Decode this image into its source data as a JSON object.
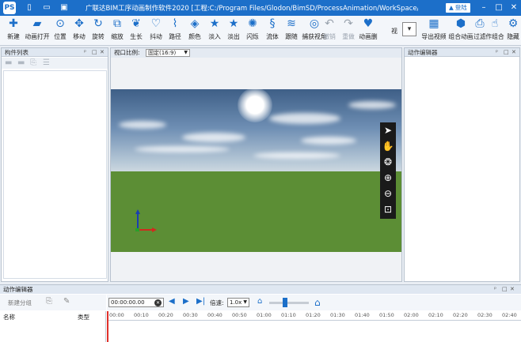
{
  "titlebar": {
    "logo": "PS",
    "title": "广联达BIM工序动画制作软件2020 [工程:C:/Program Files/Glodon/BimSD/ProcessAnimation/WorkSpace/新建项目]",
    "login_label": "登陆",
    "colors": {
      "bar": "#1c6fc9"
    }
  },
  "ribbon": {
    "tools": [
      {
        "label": "新建",
        "icon": "plus-icon"
      },
      {
        "label": "动画打开",
        "icon": "folder-open-icon"
      },
      {
        "label": "位置",
        "icon": "location-pin-icon"
      },
      {
        "label": "移动",
        "icon": "move-arrows-icon"
      },
      {
        "label": "旋转",
        "icon": "rotate-icon"
      },
      {
        "label": "缩放",
        "icon": "scale-icon"
      },
      {
        "label": "生长",
        "icon": "grow-icon"
      },
      {
        "label": "抖动",
        "icon": "shake-icon"
      },
      {
        "label": "路径",
        "icon": "path-icon"
      },
      {
        "label": "颜色",
        "icon": "paint-bucket-icon"
      },
      {
        "label": "淡入",
        "icon": "star-icon"
      },
      {
        "label": "淡出",
        "icon": "star-icon"
      },
      {
        "label": "闪烁",
        "icon": "flash-icon"
      },
      {
        "label": "流体",
        "icon": "fluid-icon"
      },
      {
        "label": "跟随",
        "icon": "follow-icon"
      },
      {
        "label": "捕获视角",
        "icon": "camera-capture-icon"
      },
      {
        "label": "撤销",
        "icon": "undo-icon",
        "disabled": true
      },
      {
        "label": "重做",
        "icon": "redo-icon",
        "disabled": true
      },
      {
        "label": "动画删",
        "icon": "delete-animation-icon"
      },
      {
        "label": "视",
        "icon": "view-icon"
      },
      {
        "label": "导出视频",
        "icon": "export-video-icon"
      },
      {
        "label": "组合动画",
        "icon": "group-animation-icon"
      },
      {
        "label": "过滤",
        "icon": "filter-icon"
      },
      {
        "label": "作组合",
        "icon": "combine-icon"
      },
      {
        "label": "隐藏",
        "icon": "hide-icon"
      }
    ]
  },
  "left_panel": {
    "title": "构件列表"
  },
  "viewport": {
    "ratio_label": "视口比例:",
    "ratio_value": "固定(16:9)"
  },
  "right_panel": {
    "title": "动作编辑器"
  },
  "bottom_panel": {
    "title": "动作编辑器",
    "new_group_label": "新建分组",
    "columns": [
      "名称",
      "类型"
    ],
    "time_value": "00:00:00.00",
    "speed_label": "倍速:",
    "speed_value": "1.0x",
    "ruler_ticks": [
      "00:00",
      "00:10",
      "00:20",
      "00:30",
      "00:40",
      "00:50",
      "01:00",
      "01:10",
      "01:20",
      "01:30",
      "01:40",
      "01:50",
      "02:00",
      "02:10",
      "02:20",
      "02:30",
      "02:40"
    ]
  }
}
